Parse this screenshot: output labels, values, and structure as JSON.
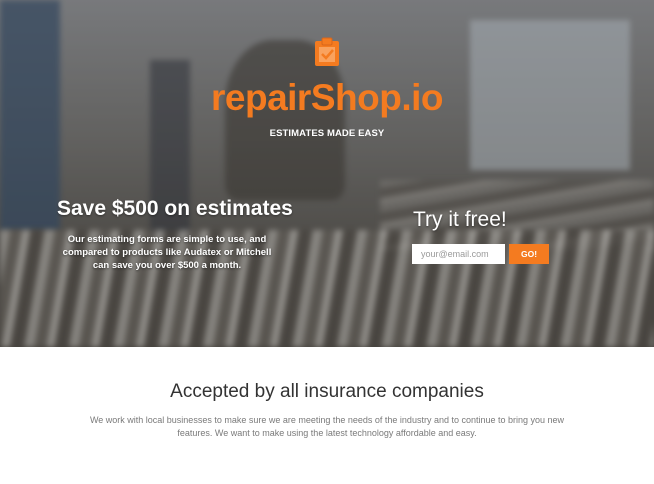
{
  "brand": {
    "name": "repairShop.io",
    "tagline": "ESTIMATES MADE EASY",
    "icon": "clipboard-icon",
    "accent_color": "#f47b20"
  },
  "hero": {
    "save_title": "Save $500 on estimates",
    "save_description": "Our estimating forms are simple to use, and compared to products like Audatex or Mitchell can save you over $500 a month.",
    "signup": {
      "title": "Try it free!",
      "email_placeholder": "your@email.com",
      "email_value": "",
      "button_label": "GO!"
    }
  },
  "insurance": {
    "title": "Accepted by all insurance companies",
    "body": "We work with local businesses to make sure we are meeting the needs of the industry and to continue to bring you new features. We want to make using the latest technology affordable and easy."
  }
}
